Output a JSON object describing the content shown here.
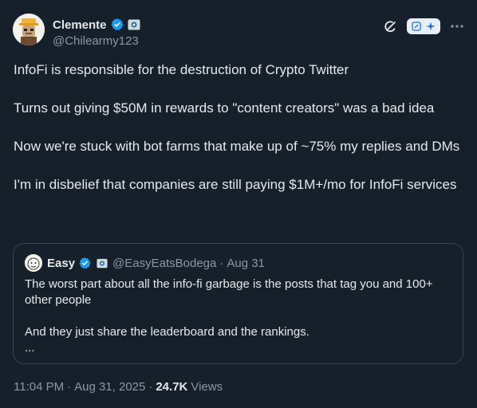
{
  "author": {
    "display_name": "Clemente",
    "handle": "@Chilearmy123"
  },
  "body": {
    "paragraphs": [
      "InfoFi is responsible for the destruction of Crypto Twitter",
      "Turns out giving $50M in rewards to \"content creators\" was a bad idea",
      "Now we're stuck with bot farms that make up of ~75% my replies and DMs",
      "I'm in disbelief that companies are still paying $1M+/mo for InfoFi services"
    ]
  },
  "quote": {
    "display_name": "Easy",
    "handle": "@EasyEatsBodega",
    "separator": "·",
    "time": "Aug 31",
    "lines": [
      "The worst part about all the info-fi garbage is the posts that tag you and 100+ other people",
      "And they just share the leaderboard and the rankings.",
      "..."
    ]
  },
  "meta": {
    "time": "11:04 PM",
    "sep1": "·",
    "date": "Aug 31, 2025",
    "sep2": "·",
    "views_count": "24.7K",
    "views_label": "Views"
  },
  "colors": {
    "background": "#15202b",
    "text": "#e7e9ea",
    "secondary": "#8b98a5",
    "border": "#38444d",
    "verified": "#1d9bf0"
  },
  "icons": [
    "verified-badge-icon",
    "affiliate-badge-icon",
    "grok-icon",
    "edit-icon",
    "sparkle-icon",
    "more-icon"
  ]
}
